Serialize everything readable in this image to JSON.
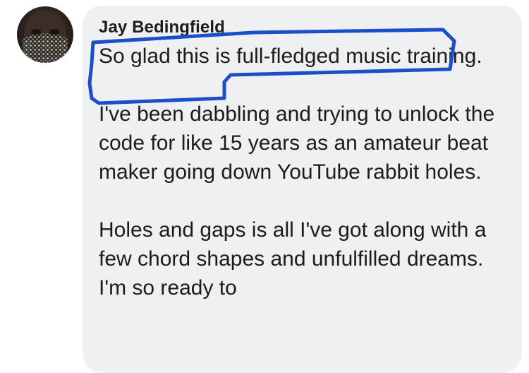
{
  "comment": {
    "author": "Jay Bedingfield",
    "paragraphs": [
      "So glad this is full-fledged music training.",
      "I've been dabbling and trying to unlock the code for like 15 years as an amateur beat maker going down YouTube rabbit holes.",
      "Holes and gaps is all I've got along with a few chord shapes and unfulfilled dreams. I'm so ready to"
    ]
  },
  "annotation": {
    "color": "#1a4fc9",
    "icon": "hand-drawn-highlight-outline"
  }
}
